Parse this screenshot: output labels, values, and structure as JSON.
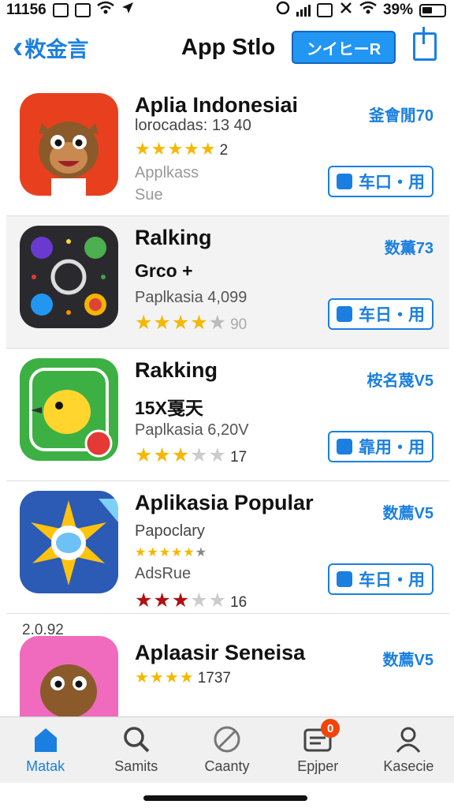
{
  "status": {
    "time": "11156",
    "battery": "39%"
  },
  "nav": {
    "back_label": "敉金言",
    "title": "App Stlo",
    "action": "ンイヒーR"
  },
  "apps": [
    {
      "name": "Aplia Indonesiai",
      "line2": "lorocadas: 13 40",
      "rating_count": "2",
      "line3": "Applkass",
      "line4": "Sue",
      "rank": "釜會閒70",
      "button": "车口・用",
      "stars": 5
    },
    {
      "name": "Ralking",
      "line2": "Grco +",
      "line3": "Paplkasia 4,099",
      "rating_count": "90",
      "rank": "数薫73",
      "button": "车日・用",
      "stars": 4.5
    },
    {
      "name": "Rakking",
      "line2": "15X戛天",
      "line3": "Paplkasia 6,20V",
      "rating_count": "17",
      "rank": "桉名蔑V5",
      "button": "靠用・用",
      "stars": 3
    },
    {
      "name": "Aplikasia Popular",
      "line2": "Papoclary",
      "line3": "AdsRue",
      "rating_count": "16",
      "rank": "数薦V5",
      "button": "车日・用",
      "stars": 3
    },
    {
      "name": "Aplaasir Seneisa",
      "rating_count": "1737",
      "rank": "数薦V5",
      "stars": 4
    }
  ],
  "version_note": "2.0.92",
  "tabs": [
    {
      "label": "Matak",
      "icon": "home-icon",
      "active": true
    },
    {
      "label": "Samits",
      "icon": "search-icon"
    },
    {
      "label": "Caanty",
      "icon": "block-icon"
    },
    {
      "label": "Epjper",
      "icon": "updates-icon",
      "badge": "0"
    },
    {
      "label": "Kasecie",
      "icon": "account-icon"
    }
  ],
  "colors": {
    "accent": "#1a7fe0",
    "star": "#f5b800",
    "badge": "#f0450a"
  }
}
